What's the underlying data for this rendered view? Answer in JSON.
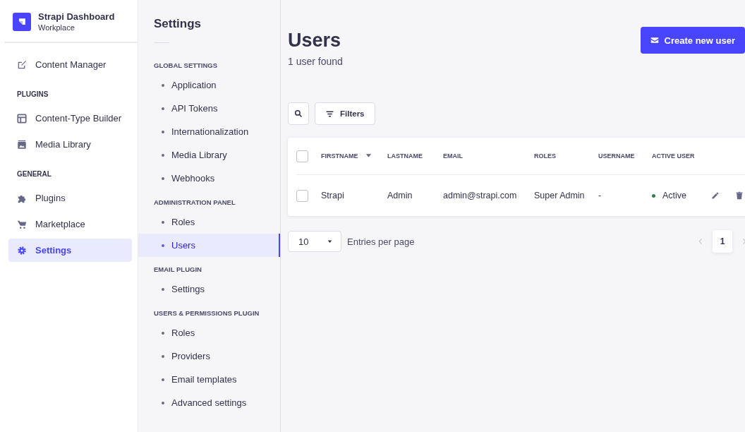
{
  "brand": {
    "title": "Strapi Dashboard",
    "subtitle": "Workplace"
  },
  "nav": [
    {
      "kind": "item",
      "label": "Content Manager",
      "selected": false
    },
    {
      "kind": "section",
      "label": "PLUGINS"
    },
    {
      "kind": "item",
      "label": "Content-Type Builder",
      "selected": false
    },
    {
      "kind": "item",
      "label": "Media Library",
      "selected": false
    },
    {
      "kind": "section",
      "label": "GENERAL"
    },
    {
      "kind": "item",
      "label": "Plugins",
      "selected": false
    },
    {
      "kind": "item",
      "label": "Marketplace",
      "selected": false
    },
    {
      "kind": "item",
      "label": "Settings",
      "selected": true
    }
  ],
  "settings": {
    "title": "Settings",
    "groups": [
      {
        "label": "GLOBAL SETTINGS",
        "items": [
          {
            "label": "Application",
            "selected": false
          },
          {
            "label": "API Tokens",
            "selected": false
          },
          {
            "label": "Internationalization",
            "selected": false
          },
          {
            "label": "Media Library",
            "selected": false
          },
          {
            "label": "Webhooks",
            "selected": false
          }
        ]
      },
      {
        "label": "ADMINISTRATION PANEL",
        "items": [
          {
            "label": "Roles",
            "selected": false
          },
          {
            "label": "Users",
            "selected": true
          }
        ]
      },
      {
        "label": "EMAIL PLUGIN",
        "items": [
          {
            "label": "Settings",
            "selected": false
          }
        ]
      },
      {
        "label": "USERS & PERMISSIONS PLUGIN",
        "items": [
          {
            "label": "Roles",
            "selected": false
          },
          {
            "label": "Providers",
            "selected": false
          },
          {
            "label": "Email templates",
            "selected": false
          },
          {
            "label": "Advanced settings",
            "selected": false
          }
        ]
      }
    ]
  },
  "page": {
    "title": "Users",
    "subtitle": "1 user found",
    "create_button": "Create new user",
    "filters_button": "Filters"
  },
  "table": {
    "all_checked": false,
    "columns": [
      "FIRSTNAME",
      "LASTNAME",
      "EMAIL",
      "ROLES",
      "USERNAME",
      "ACTIVE USER"
    ],
    "rows": [
      {
        "checked": false,
        "cells": [
          "Strapi",
          "Admin",
          "admin@strapi.com",
          "Super Admin",
          "-"
        ],
        "status": "Active",
        "active": true
      }
    ]
  },
  "pagination": {
    "page_size": "10",
    "entries_label": "Entries per page",
    "pages": [
      {
        "label": "1",
        "selected": true
      }
    ]
  }
}
